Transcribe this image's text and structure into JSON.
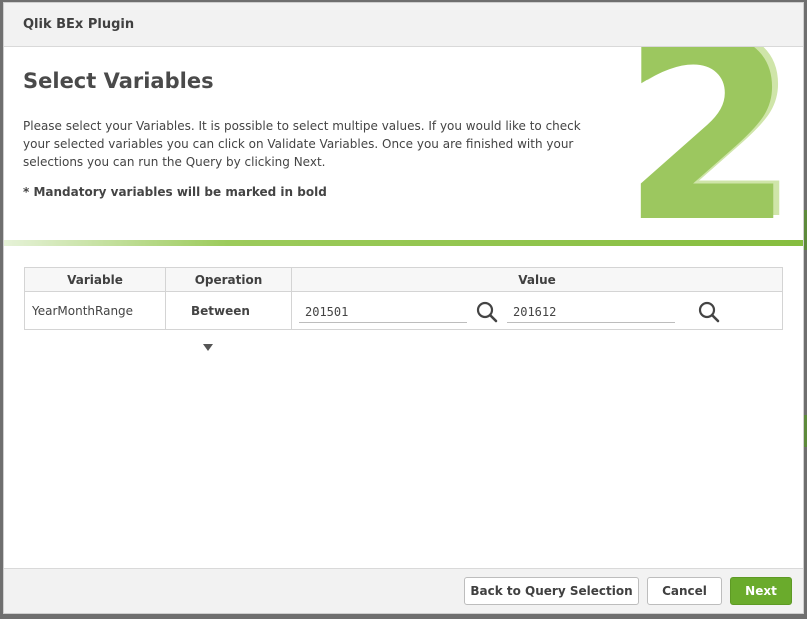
{
  "dialog": {
    "title": "Qlik BEx Plugin"
  },
  "header": {
    "heading": "Select Variables",
    "description": "Please select your Variables. It is possible to select multipe values. If you would like to check your selected variables you can click on Validate Variables. Once you are finished with your selections you can run the Query by clicking Next.",
    "mandatory_note": "* Mandatory variables will be marked in bold",
    "step_number": "2"
  },
  "table": {
    "headers": {
      "variable": "Variable",
      "operation": "Operation",
      "value": "Value"
    },
    "rows": [
      {
        "variable": "YearMonthRange",
        "operation": "Between",
        "value_low": "201501",
        "value_high": "201612"
      }
    ]
  },
  "footer": {
    "back_label": "Back to Query Selection",
    "cancel_label": "Cancel",
    "next_label": "Next"
  },
  "colors": {
    "accent": "#6aab2c",
    "step_graphic": "#9cc75f"
  },
  "icons": {
    "search": "search-icon",
    "dropdown": "dropdown-arrow-icon"
  }
}
